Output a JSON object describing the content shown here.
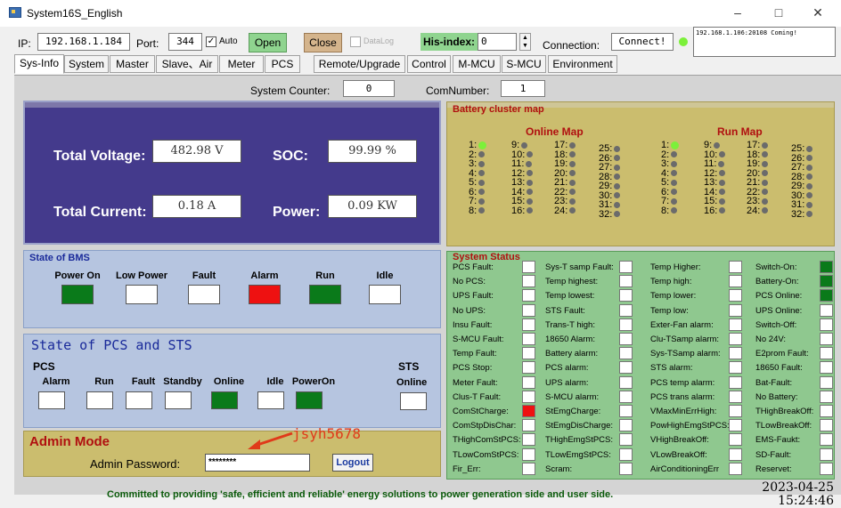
{
  "window": {
    "title": "System16S_English",
    "min": "–",
    "max": "□",
    "close": "✕"
  },
  "conn": {
    "ip_label": "IP:",
    "ip": "192.168.1.184",
    "port_label": "Port:",
    "port": "344",
    "auto_label": "Auto",
    "auto_checked": "✓",
    "open": "Open",
    "close": "Close",
    "datalog": "DataLog",
    "his_label": "His-index:",
    "his_value": "0",
    "connection_label": "Connection:",
    "connection_value": "Connect!",
    "log": "192.168.1.106:20108 Coming!"
  },
  "tabs": [
    "Sys-Info",
    "System",
    "Master",
    "Slave、Air",
    "Meter",
    "PCS",
    "Remote/Upgrade",
    "Control",
    "M-MCU",
    "S-MCU",
    "Environment"
  ],
  "counter": {
    "label": "System Counter:",
    "value": "0",
    "com_label": "ComNumber:",
    "com_value": "1"
  },
  "totals": {
    "voltage_label": "Total Voltage:",
    "voltage": "482.98 V",
    "soc_label": "SOC:",
    "soc": "99.99 %",
    "current_label": "Total Current:",
    "current": "0.18 A",
    "power_label": "Power:",
    "power": "0.09 KW"
  },
  "bms": {
    "title": "State of BMS",
    "states": [
      {
        "label": "Power On",
        "color": "#0a7a1a"
      },
      {
        "label": "Low Power",
        "color": "#ffffff"
      },
      {
        "label": "Fault",
        "color": "#ffffff"
      },
      {
        "label": "Alarm",
        "color": "#ee1111"
      },
      {
        "label": "Run",
        "color": "#0a7a1a"
      },
      {
        "label": "Idle",
        "color": "#ffffff"
      }
    ]
  },
  "pcs": {
    "title": "State of PCS and STS",
    "pcs_label": "PCS",
    "sts_label": "STS",
    "states": [
      {
        "label": "Alarm",
        "color": "#ffffff"
      },
      {
        "label": "Run",
        "color": "#ffffff"
      },
      {
        "label": "Fault",
        "color": "#ffffff"
      },
      {
        "label": "Standby",
        "color": "#ffffff"
      },
      {
        "label": "Online",
        "color": "#0a7a1a"
      },
      {
        "label": "Idle",
        "color": "#ffffff"
      },
      {
        "label": "PowerOn",
        "color": "#0a7a1a"
      }
    ],
    "sts_online_label": "Online",
    "sts_online_color": "#ffffff"
  },
  "admin": {
    "title": "Admin Mode",
    "password_label": "Admin Password:",
    "password": "********",
    "logout": "Logout",
    "annotation": "jsyh5678"
  },
  "battery": {
    "title": "Battery cluster map",
    "online_title": "Online Map",
    "run_title": "Run Map",
    "online_active": [
      1
    ],
    "run_active": [
      1
    ]
  },
  "system_status": {
    "title": "System Status",
    "columns": [
      [
        {
          "label": "PCS Fault:",
          "color": "#ffffff"
        },
        {
          "label": "No PCS:",
          "color": "#ffffff"
        },
        {
          "label": "UPS Fault:",
          "color": "#ffffff"
        },
        {
          "label": "No UPS:",
          "color": "#ffffff"
        },
        {
          "label": "Insu Fault:",
          "color": "#ffffff"
        },
        {
          "label": "S-MCU Fault:",
          "color": "#ffffff"
        },
        {
          "label": "Temp Fault:",
          "color": "#ffffff"
        },
        {
          "label": "PCS Stop:",
          "color": "#ffffff"
        },
        {
          "label": "Meter Fault:",
          "color": "#ffffff"
        },
        {
          "label": "Clus-T Fault:",
          "color": "#ffffff"
        },
        {
          "label": "ComStCharge:",
          "color": "#ee1111"
        },
        {
          "label": "ComStpDisChar:",
          "color": "#ffffff"
        },
        {
          "label": "THighComStPCS:",
          "color": "#ffffff"
        },
        {
          "label": "TLowComStPCS:",
          "color": "#ffffff"
        },
        {
          "label": "Fir_Err:",
          "color": "#ffffff"
        }
      ],
      [
        {
          "label": "Sys-T samp Fault:",
          "color": "#ffffff"
        },
        {
          "label": "Temp highest:",
          "color": "#ffffff"
        },
        {
          "label": "Temp lowest:",
          "color": "#ffffff"
        },
        {
          "label": "STS Fault:",
          "color": "#ffffff"
        },
        {
          "label": "Trans-T high:",
          "color": "#ffffff"
        },
        {
          "label": "18650 Alarm:",
          "color": "#ffffff"
        },
        {
          "label": "Battery alarm:",
          "color": "#ffffff"
        },
        {
          "label": "PCS alarm:",
          "color": "#ffffff"
        },
        {
          "label": "UPS alarm:",
          "color": "#ffffff"
        },
        {
          "label": "S-MCU alarm:",
          "color": "#ffffff"
        },
        {
          "label": "StEmgCharge:",
          "color": "#ffffff"
        },
        {
          "label": "StEmgDisCharge:",
          "color": "#ffffff"
        },
        {
          "label": "THighEmgStPCS:",
          "color": "#ffffff"
        },
        {
          "label": "TLowEmgStPCS:",
          "color": "#ffffff"
        },
        {
          "label": "Scram:",
          "color": "#ffffff"
        }
      ],
      [
        {
          "label": "Temp Higher:",
          "color": "#ffffff"
        },
        {
          "label": "Temp high:",
          "color": "#ffffff"
        },
        {
          "label": "Temp lower:",
          "color": "#ffffff"
        },
        {
          "label": "Temp low:",
          "color": "#ffffff"
        },
        {
          "label": "Exter-Fan alarm:",
          "color": "#ffffff"
        },
        {
          "label": "Clu-TSamp alarm:",
          "color": "#ffffff"
        },
        {
          "label": "Sys-TSamp alarm:",
          "color": "#ffffff"
        },
        {
          "label": "STS alarm:",
          "color": "#ffffff"
        },
        {
          "label": "PCS temp alarm:",
          "color": "#ffffff"
        },
        {
          "label": "PCS trans alarm:",
          "color": "#ffffff"
        },
        {
          "label": "VMaxMinErrHigh:",
          "color": "#ffffff"
        },
        {
          "label": "PowHighEmgStPCS:",
          "color": "#ffffff"
        },
        {
          "label": "VHighBreakOff:",
          "color": "#ffffff"
        },
        {
          "label": "VLowBreakOff:",
          "color": "#ffffff"
        },
        {
          "label": "AirConditioningErr",
          "color": "#ffffff"
        }
      ],
      [
        {
          "label": "Switch-On:",
          "color": "#0a7a1a"
        },
        {
          "label": "Battery-On:",
          "color": "#0a7a1a"
        },
        {
          "label": "PCS Online:",
          "color": "#0a7a1a"
        },
        {
          "label": "UPS Online:",
          "color": "#ffffff"
        },
        {
          "label": "Switch-Off:",
          "color": "#ffffff"
        },
        {
          "label": "No 24V:",
          "color": "#ffffff"
        },
        {
          "label": "E2prom Fault:",
          "color": "#ffffff"
        },
        {
          "label": "18650 Fault:",
          "color": "#ffffff"
        },
        {
          "label": "Bat-Fault:",
          "color": "#ffffff"
        },
        {
          "label": "No Battery:",
          "color": "#ffffff"
        },
        {
          "label": "THighBreakOff:",
          "color": "#ffffff"
        },
        {
          "label": "TLowBreakOff:",
          "color": "#ffffff"
        },
        {
          "label": "EMS-Faukt:",
          "color": "#ffffff"
        },
        {
          "label": "SD-Fault:",
          "color": "#ffffff"
        },
        {
          "label": "Reservet:",
          "color": "#ffffff"
        }
      ]
    ]
  },
  "footer": {
    "text": "Committed to providing 'safe, efficient and reliable' energy solutions to power generation side and user side.",
    "date": "2023-04-25",
    "time": "15:24:46"
  }
}
